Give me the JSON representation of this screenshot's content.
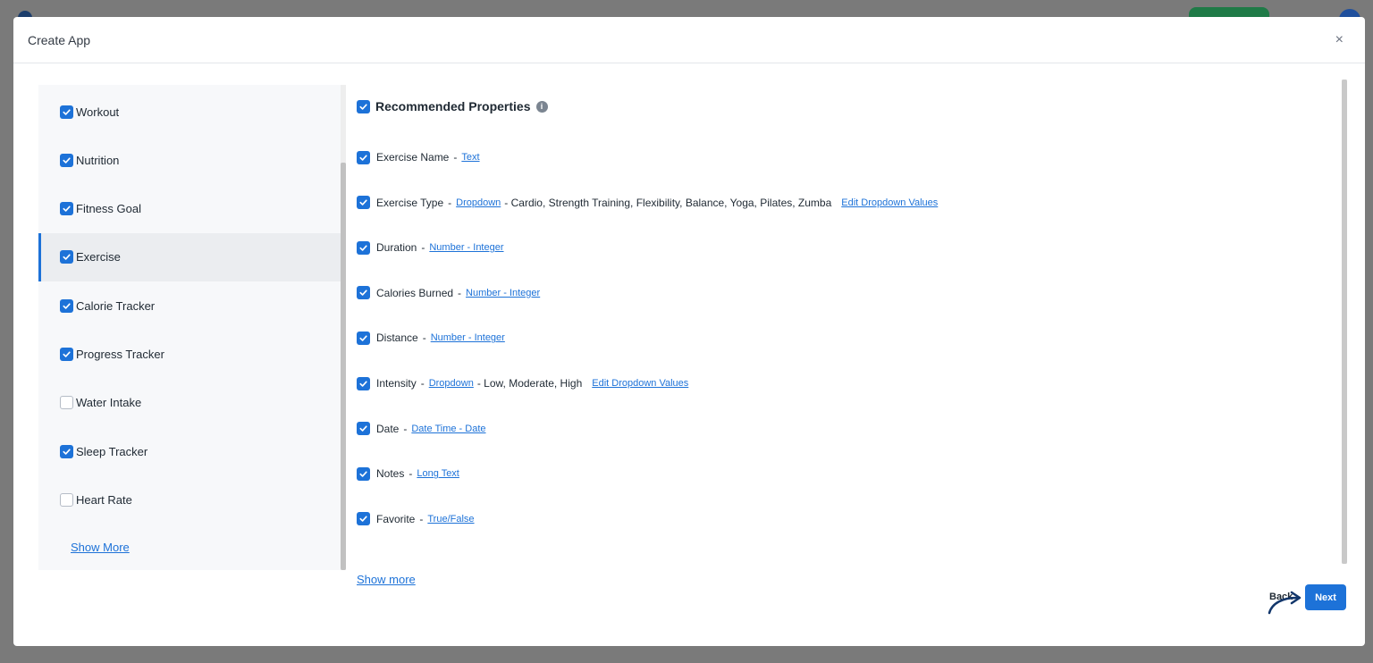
{
  "modal": {
    "title": "Create App",
    "close_label": "×"
  },
  "categories": [
    {
      "label": "Workout",
      "checked": true,
      "active": false
    },
    {
      "label": "Nutrition",
      "checked": true,
      "active": false
    },
    {
      "label": "Fitness Goal",
      "checked": true,
      "active": false
    },
    {
      "label": "Exercise",
      "checked": true,
      "active": true
    },
    {
      "label": "Calorie Tracker",
      "checked": true,
      "active": false
    },
    {
      "label": "Progress Tracker",
      "checked": true,
      "active": false
    },
    {
      "label": "Water Intake",
      "checked": false,
      "active": false
    },
    {
      "label": "Sleep Tracker",
      "checked": true,
      "active": false
    },
    {
      "label": "Heart Rate",
      "checked": false,
      "active": false
    }
  ],
  "left_show_more": "Show More",
  "recommended": {
    "title": "Recommended Properties",
    "info_icon": "i",
    "checked": true
  },
  "properties": [
    {
      "name": "Exercise Name",
      "type": "Text",
      "options": "",
      "edit": ""
    },
    {
      "name": "Exercise Type",
      "type": "Dropdown",
      "options": "Cardio, Strength Training, Flexibility, Balance, Yoga, Pilates, Zumba",
      "edit": "Edit Dropdown Values"
    },
    {
      "name": "Duration",
      "type": "Number - Integer",
      "options": "",
      "edit": ""
    },
    {
      "name": "Calories Burned",
      "type": "Number - Integer",
      "options": "",
      "edit": ""
    },
    {
      "name": "Distance",
      "type": "Number - Integer",
      "options": "",
      "edit": ""
    },
    {
      "name": "Intensity",
      "type": "Dropdown",
      "options": "Low, Moderate, High",
      "edit": "Edit Dropdown Values"
    },
    {
      "name": "Date",
      "type": "Date Time - Date",
      "options": "",
      "edit": ""
    },
    {
      "name": "Notes",
      "type": "Long Text",
      "options": "",
      "edit": ""
    },
    {
      "name": "Favorite",
      "type": "True/False",
      "options": "",
      "edit": ""
    }
  ],
  "right_show_more": "Show more",
  "footer": {
    "back_label": "Back",
    "next_label": "Next"
  },
  "colors": {
    "accent": "#1d72d8",
    "overlay": "#7a7a7a"
  }
}
